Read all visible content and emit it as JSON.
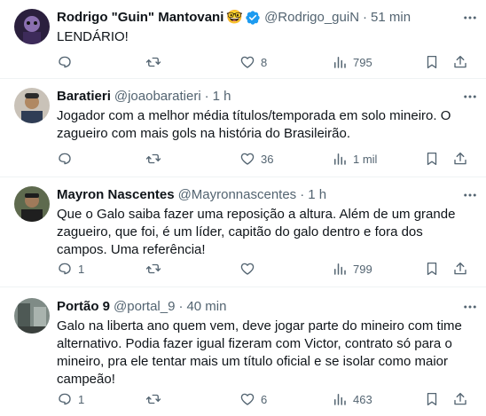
{
  "tweets": [
    {
      "name": "Rodrigo \"Guin\" Mantovani",
      "emoji": "🤓",
      "verified": true,
      "handle": "@Rodrigo_guiN",
      "time": "51 min",
      "text": "LENDÁRIO!",
      "replies": "",
      "retweets": "",
      "likes": "8",
      "views": "795"
    },
    {
      "name": "Baratieri",
      "handle": "@joaobaratieri",
      "time": "1 h",
      "text": "Jogador com a melhor média títulos/temporada em solo mineiro. O zagueiro com mais gols na história do Brasileirão.",
      "replies": "",
      "retweets": "",
      "likes": "36",
      "views": "1 mil"
    },
    {
      "name": "Mayron Nascentes",
      "handle": "@Mayronnascentes",
      "time": "1 h",
      "text": "Que o Galo saiba fazer uma reposição a altura. Além de um grande zagueiro, que foi, é um líder, capitão do galo dentro e fora dos campos. Uma referência!",
      "replies": "1",
      "retweets": "",
      "likes": "",
      "views": "799"
    },
    {
      "name": "Portão 9",
      "handle": "@portal_9",
      "time": "40 min",
      "text": "Galo na liberta ano quem vem, deve jogar parte do mineiro com time alternativo. Podia fazer igual fizeram com Victor, contrato só para o mineiro, pra ele tentar mais um título oficial e se isolar como maior campeão!",
      "replies": "1",
      "retweets": "",
      "likes": "6",
      "views": "463"
    }
  ],
  "colors": {
    "muted": "#536471",
    "text": "#0f1419",
    "verified": "#1d9bf0",
    "divider": "#eff3f4"
  },
  "icons": [
    "more-icon",
    "reply-icon",
    "retweet-icon",
    "like-icon",
    "views-icon",
    "bookmark-icon",
    "share-icon",
    "verified-badge-icon"
  ]
}
